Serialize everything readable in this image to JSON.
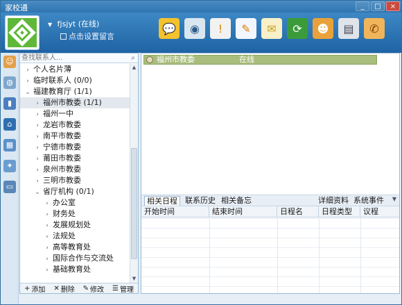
{
  "window": {
    "title": "家校通",
    "controls": [
      "_",
      "□",
      "×"
    ]
  },
  "user": {
    "account": "fjsjyt",
    "status": "(在线)",
    "signature_hint": "点击设置留言"
  },
  "toolbar_icons": [
    "chat-icon",
    "webcam-icon",
    "notice-icon",
    "edit-icon",
    "mail-icon",
    "refresh-icon",
    "group-icon",
    "broadcast-icon",
    "phone-icon"
  ],
  "vstrip_icons": [
    "contacts-icon",
    "chat-icon",
    "device-icon",
    "home-icon",
    "calendar-icon",
    "tools-icon",
    "window-icon"
  ],
  "search": {
    "placeholder": "查找联系人..."
  },
  "tree": [
    {
      "label": "个人名片薄",
      "depth": 0,
      "arrow": "›"
    },
    {
      "label": "临时联系人 (0/0)",
      "depth": 0,
      "arrow": "›"
    },
    {
      "label": "福建教育厅 (1/1)",
      "depth": 0,
      "arrow": "⌄"
    },
    {
      "label": "福州市教委 (1/1)",
      "depth": 1,
      "arrow": "›",
      "selected": true
    },
    {
      "label": "福州一中",
      "depth": 1,
      "arrow": "›"
    },
    {
      "label": "龙岩市教委",
      "depth": 1,
      "arrow": "›"
    },
    {
      "label": "南平市教委",
      "depth": 1,
      "arrow": "›"
    },
    {
      "label": "宁德市教委",
      "depth": 1,
      "arrow": "›"
    },
    {
      "label": "莆田市教委",
      "depth": 1,
      "arrow": "›"
    },
    {
      "label": "泉州市教委",
      "depth": 1,
      "arrow": "›"
    },
    {
      "label": "三明市教委",
      "depth": 1,
      "arrow": "›"
    },
    {
      "label": "省厅机构 (0/1)",
      "depth": 1,
      "arrow": "⌄"
    },
    {
      "label": "办公室",
      "depth": 2,
      "arrow": "›"
    },
    {
      "label": "财务处",
      "depth": 2,
      "arrow": "›"
    },
    {
      "label": "发展规划处",
      "depth": 2,
      "arrow": "›"
    },
    {
      "label": "法规处",
      "depth": 2,
      "arrow": "›"
    },
    {
      "label": "高等教育处",
      "depth": 2,
      "arrow": "›"
    },
    {
      "label": "国际合作与交流处",
      "depth": 2,
      "arrow": "›"
    },
    {
      "label": "基础教育处",
      "depth": 2,
      "arrow": "›"
    }
  ],
  "bottom_actions": {
    "add": "添加",
    "delete": "删除",
    "edit": "修改",
    "manage": "管理"
  },
  "session": {
    "name": "福州市教委",
    "status": "在线"
  },
  "tabs": {
    "schedule": "相关日程",
    "history": "联系历史",
    "memo": "相关备忘",
    "details": "详细资料",
    "events": "系统事件"
  },
  "table": {
    "columns": [
      "开始时间",
      "结束时间",
      "日程名",
      "日程类型",
      "议程"
    ]
  }
}
